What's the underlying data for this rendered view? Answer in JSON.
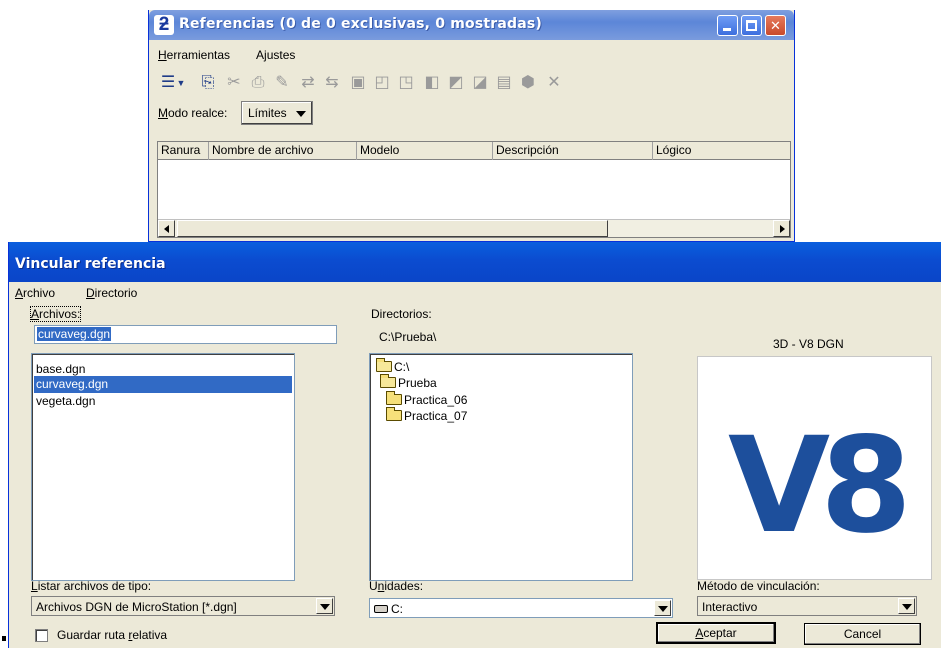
{
  "references_window": {
    "title": "Referencias (0 de 0 exclusivas, 0 mostradas)",
    "app_icon": "microstation-icon",
    "menu": {
      "tools_hotkey": "H",
      "tools_rest": "erramientas",
      "settings_pre": "A",
      "settings_hotkey": "j",
      "settings_rest": "ustes"
    },
    "toolbar_icons": [
      "list-view-icon",
      "attach-reference-icon",
      "detach-icon",
      "reload-icon",
      "edit-icon",
      "hilite-icon",
      "move-icon",
      "copy-icon",
      "scale-icon",
      "rotate-icon",
      "mirror-icon",
      "clip-icon",
      "mask-icon",
      "delete-clip-icon",
      "3d-icon",
      "tools-icon"
    ],
    "mode_label_hotkey": "M",
    "mode_label_rest": "odo realce:",
    "mode_value": "Límites",
    "table_columns": [
      "Ranura",
      "Nombre de archivo",
      "Modelo",
      "Descripción",
      "Lógico"
    ],
    "rows": []
  },
  "attach_dialog": {
    "title": "Vincular referencia",
    "menu": {
      "file_hotkey": "A",
      "file_rest": "rchivo",
      "dir_hotkey": "D",
      "dir_rest": "irectorio"
    },
    "files_label_hotkey": "A",
    "files_label_rest": "rchivos:",
    "file_name_value": "curvaveg.dgn",
    "files": [
      "base.dgn",
      "curvaveg.dgn",
      "vegeta.dgn"
    ],
    "selected_file_index": 1,
    "directories_label": "Directorios:",
    "current_path": "C:\\Prueba\\",
    "directories": [
      "C:\\",
      "Prueba",
      "Practica_06",
      "Practica_07"
    ],
    "preview_caption": "3D - V8 DGN",
    "preview_logo_text": "V8",
    "type_label_hotkey": "L",
    "type_label_rest": "istar archivos de tipo:",
    "type_value": "Archivos DGN de MicroStation [*.dgn]",
    "units_label_pre": "U",
    "units_label_hotkey": "n",
    "units_label_rest": "idades:",
    "units_value": "C:",
    "method_label": "Método de vinculación:",
    "method_value": "Interactivo",
    "relative_path_pre": "Guardar ruta ",
    "relative_path_hotkey": "r",
    "relative_path_rest": "elativa",
    "accept_hotkey": "A",
    "accept_rest": "ceptar",
    "cancel_label": "Cancel"
  },
  "colors": {
    "xp_face": "#ece9d8",
    "dialog_titlebar": "#0a4cd0",
    "selection": "#316ac5",
    "v8_blue": "#1d4f9c"
  }
}
